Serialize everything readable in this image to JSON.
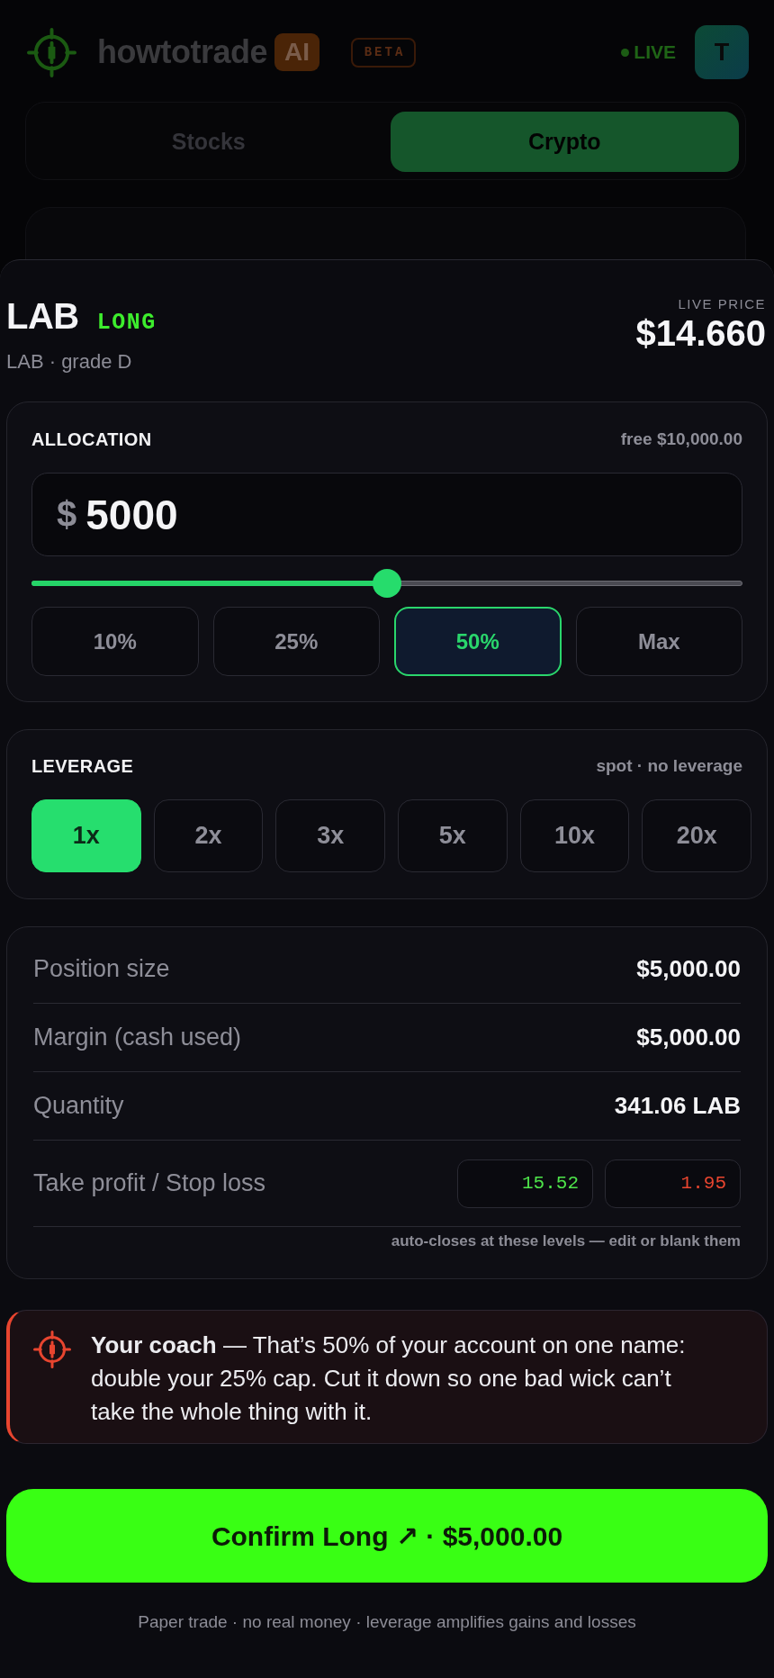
{
  "header": {
    "brand": "howtotrade",
    "brand_badge": "AI",
    "beta_badge": "BETA",
    "live_label": "LIVE",
    "avatar_initial": "T"
  },
  "market_tabs": [
    {
      "label": "Stocks",
      "selected": false
    },
    {
      "label": "Crypto",
      "selected": true
    }
  ],
  "order_sheet": {
    "symbol": "LAB",
    "side": "LONG",
    "subtitle": "LAB · grade D",
    "price_label": "LIVE PRICE",
    "price": "$14.660",
    "allocation": {
      "title": "ALLOCATION",
      "free": "free $10,000.00",
      "currency": "$",
      "amount": "5000",
      "level": 0.5,
      "presets": [
        {
          "label": "10%",
          "selected": false
        },
        {
          "label": "25%",
          "selected": false
        },
        {
          "label": "50%",
          "selected": true
        },
        {
          "label": "Max",
          "selected": false
        }
      ]
    },
    "leverage": {
      "title": "LEVERAGE",
      "note": "spot · no leverage",
      "options": [
        {
          "label": "1x",
          "selected": true
        },
        {
          "label": "2x",
          "selected": false
        },
        {
          "label": "3x",
          "selected": false
        },
        {
          "label": "5x",
          "selected": false
        },
        {
          "label": "10x",
          "selected": false
        },
        {
          "label": "20x",
          "selected": false
        }
      ]
    },
    "summary": {
      "rows": [
        {
          "kind": "value",
          "label": "Position size",
          "value": "$5,000.00"
        },
        {
          "kind": "value",
          "label": "Margin (cash used)",
          "value": "$5,000.00"
        },
        {
          "kind": "value",
          "label": "Quantity",
          "value": "341.06 LAB"
        },
        {
          "kind": "levels",
          "label": "Take profit / Stop loss",
          "levels": [
            {
              "kind": "take_profit",
              "value": "15.52"
            },
            {
              "kind": "stop_loss",
              "value": "1.95"
            }
          ]
        }
      ],
      "note": "auto-closes at these levels — edit or blank them"
    },
    "coach": {
      "message": "**Your coach** — That’s 50% of your account on one name: double your 25% cap. Cut it down so one bad wick can’t take the whole thing with it."
    },
    "confirm_button": "Confirm Long ↗ · $5,000.00",
    "disclaimer": "Paper trade · no real money · leverage amplifies gains and losses"
  }
}
